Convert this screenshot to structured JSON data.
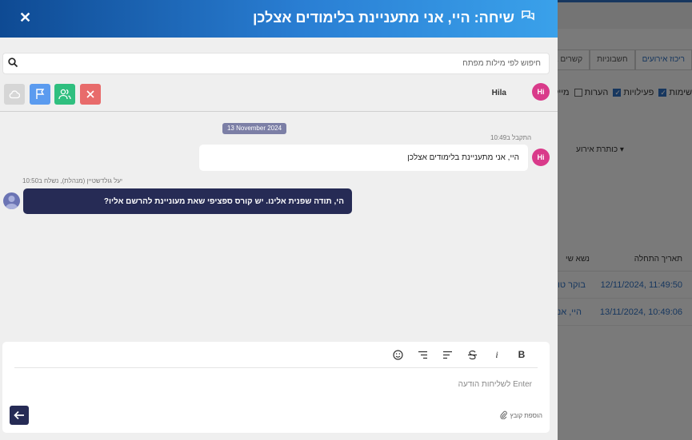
{
  "background": {
    "tabs": [
      "ריכוז אירועים",
      "חשבוניות",
      "קשרים בין לקוחות"
    ],
    "filters": [
      {
        "label": "שימות",
        "checked": true
      },
      {
        "label": "פעילויות",
        "checked": true
      },
      {
        "label": "הערות",
        "checked": false
      },
      {
        "label": "מיילים",
        "checked": false
      }
    ],
    "column_title": "כותרת אירוע",
    "table_headers": {
      "start_date": "תאריך התחלה",
      "subject": "נשא שי"
    },
    "rows": [
      {
        "date": "12/11/2024, 11:49:50",
        "subject": "בוקר טו"
      },
      {
        "date": "13/11/2024, 10:49:06",
        "subject": "היי, אנ"
      }
    ]
  },
  "header": {
    "title": "שיחה: היי, אני מתעניינת בלימודים אצלכן",
    "close_glyph": "✕"
  },
  "search": {
    "placeholder": "חיפוש לפי מילות מפתח"
  },
  "user": {
    "name": "Hila",
    "initials": "Hi"
  },
  "actions": {
    "colors": {
      "close": "#e86b6b",
      "users": "#2fbf7f",
      "flag": "#5b9bef",
      "cloud": "#d6d6d6"
    }
  },
  "messages": {
    "date_badge": "13 November 2024",
    "incoming": {
      "meta": "התקבל ב10:49",
      "text": "היי, אני מתעניינת בלימודים אצלכן",
      "initials": "Hi"
    },
    "outgoing": {
      "meta": "יעל גולדשטיין (מנהלת), נשלח ב10:50",
      "text": "הי, תודה שפנית אלינו. יש קורס ספציפי שאת מעוניינת להרשם אליו?"
    }
  },
  "composer": {
    "toolbar": {
      "bold": "B",
      "italic": "i"
    },
    "placeholder": "Enter לשליחות הודעה",
    "attach_label": "הוספת קובץ"
  },
  "colors": {
    "header_start": "#0e4a93",
    "header_end": "#3aa1ea",
    "accent_dark": "#262b55",
    "avatar": "#d93a8a"
  }
}
